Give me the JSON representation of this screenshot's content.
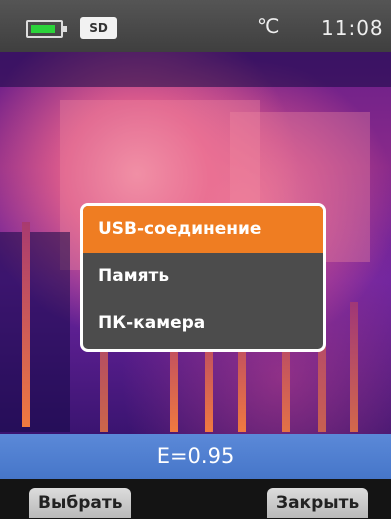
{
  "status_bar": {
    "battery_icon": "battery-icon",
    "sd_label": "SD",
    "temperature_unit": "℃",
    "time": "11:08"
  },
  "menu": {
    "items": [
      {
        "label": "USB-соединение",
        "selected": true
      },
      {
        "label": "Память",
        "selected": false
      },
      {
        "label": "ПК-камера",
        "selected": false
      }
    ]
  },
  "emissivity": {
    "label": "E=0.95"
  },
  "softkeys": {
    "left_label": "Выбрать",
    "right_label": "Закрыть"
  },
  "colors": {
    "selected_item": "#ef7d22",
    "menu_background": "#4c4c4c",
    "emissivity_bar": "#4f7fd0",
    "battery_fill": "#2bd33a"
  }
}
